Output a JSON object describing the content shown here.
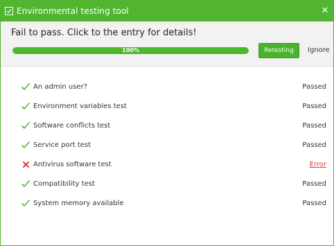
{
  "window": {
    "title": "Environmental testing tool",
    "close_glyph": "✕"
  },
  "header": {
    "status_message": "Fail to pass. Click to the entry for details!",
    "progress": {
      "value_percent": 100,
      "label": "100%"
    },
    "retest_label": "Retesting",
    "ignore_label": "Ignore"
  },
  "colors": {
    "accent": "#52b531",
    "progress_fill": "#4db82e",
    "check": "#52b531",
    "error": "#e03a2e"
  },
  "tests": [
    {
      "label": "An admin user?",
      "status": "Passed",
      "icon": "check-icon"
    },
    {
      "label": "Environment variables test",
      "status": "Passed",
      "icon": "check-icon"
    },
    {
      "label": "Software conflicts test",
      "status": "Passed",
      "icon": "check-icon"
    },
    {
      "label": "Service port test",
      "status": "Passed",
      "icon": "check-icon"
    },
    {
      "label": "Antivirus software test",
      "status": "Error",
      "icon": "cross-icon"
    },
    {
      "label": "Compatibility test",
      "status": "Passed",
      "icon": "check-icon"
    },
    {
      "label": "System memory available",
      "status": "Passed",
      "icon": "check-icon"
    }
  ]
}
